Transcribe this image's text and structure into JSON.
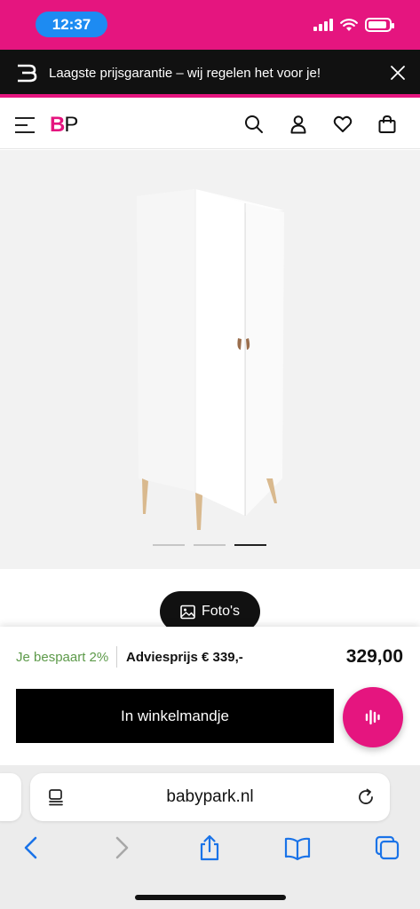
{
  "status_bar": {
    "time": "12:37"
  },
  "promo": {
    "text": "Laagste prijsgarantie – wij regelen het voor je!"
  },
  "header": {
    "logo_b": "B",
    "logo_p": "P"
  },
  "gallery": {
    "slide_count": 3,
    "active_slide": 3
  },
  "photos_button": {
    "label": "Foto's"
  },
  "purchase": {
    "savings": "Je bespaart 2%",
    "advice_price": "Adviesprijs € 339,-",
    "price": "329,00",
    "cart_button": "In winkelmandje"
  },
  "browser": {
    "url": "babypark.nl"
  },
  "colors": {
    "brand": "#e5157f",
    "savings_green": "#5d9a4a",
    "safari_blue": "#1a73e8"
  }
}
